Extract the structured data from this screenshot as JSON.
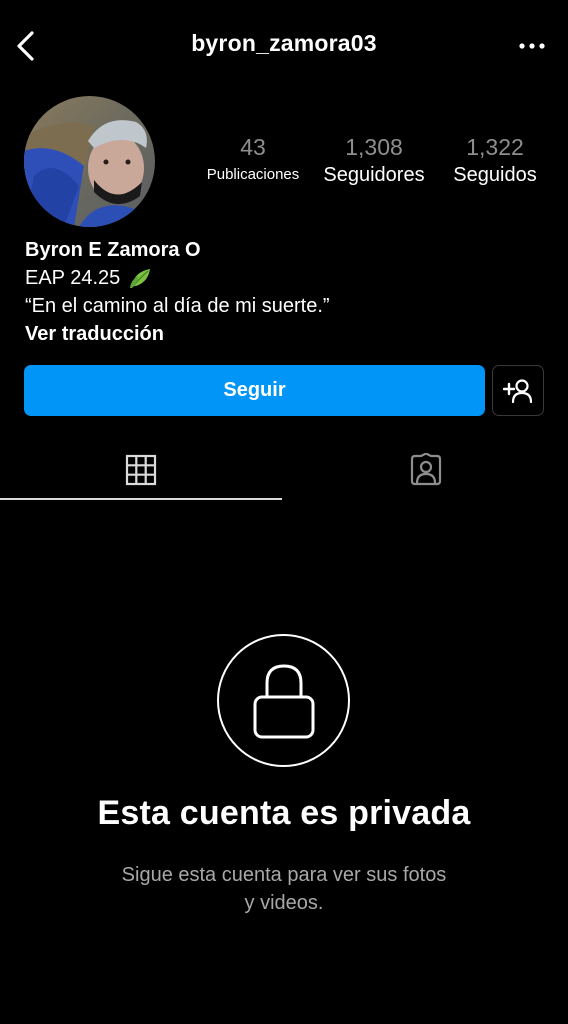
{
  "header": {
    "username": "byron_zamora03",
    "back_icon": "chevron-left-icon",
    "more_icon": "more-horizontal-icon"
  },
  "profile": {
    "avatar": "profile-photo",
    "stats": {
      "posts": {
        "value": "43",
        "label": "Publicaciones"
      },
      "followers": {
        "value": "1,308",
        "label": "Seguidores"
      },
      "following": {
        "value": "1,322",
        "label": "Seguidos"
      }
    },
    "bio": {
      "name": "Byron E Zamora O",
      "line2": "EAP 24.25",
      "emoji": "leaf-emoji",
      "quote": "“En el camino al día de mi suerte.”",
      "translate": "Ver traducción"
    }
  },
  "actions": {
    "follow_label": "Seguir",
    "suggest_icon": "add-person-icon"
  },
  "tabs": [
    {
      "icon": "grid-icon",
      "active": true
    },
    {
      "icon": "tagged-person-icon",
      "active": false
    }
  ],
  "private_notice": {
    "icon": "lock-icon",
    "title": "Esta cuenta es privada",
    "subtitle_line1": "Sigue esta cuenta para ver sus fotos",
    "subtitle_line2": "y videos."
  },
  "colors": {
    "background": "#000000",
    "accent": "#0095f6",
    "muted": "#8e8e8e",
    "subtext": "#a8a8a8"
  }
}
